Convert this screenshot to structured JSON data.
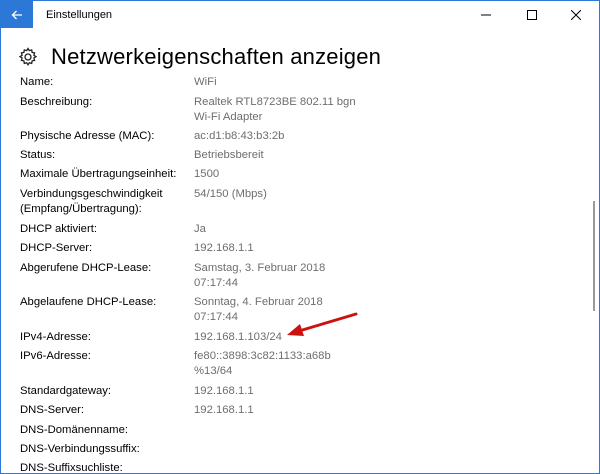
{
  "window": {
    "app_title": "Einstellungen",
    "accent": "#2b78d6"
  },
  "header": {
    "title": "Netzwerkeigenschaften anzeigen",
    "icon": "gear-icon"
  },
  "properties": [
    {
      "label": "Name:",
      "value": "WiFi"
    },
    {
      "label": "Beschreibung:",
      "value": "Realtek RTL8723BE 802.11 bgn\nWi-Fi Adapter"
    },
    {
      "label": "Physische Adresse (MAC):",
      "value": "ac:d1:b8:43:b3:2b"
    },
    {
      "label": "Status:",
      "value": "Betriebsbereit"
    },
    {
      "label": "Maximale Übertragungseinheit:",
      "value": "1500"
    },
    {
      "label": "Verbindungsgeschwindigkeit\n(Empfang/Übertragung):",
      "value": "54/150 (Mbps)"
    },
    {
      "label": "DHCP aktiviert:",
      "value": "Ja"
    },
    {
      "label": "DHCP-Server:",
      "value": "192.168.1.1"
    },
    {
      "label": "Abgerufene DHCP-Lease:",
      "value": "Samstag, 3. Februar 2018\n07:17:44"
    },
    {
      "label": "Abgelaufene DHCP-Lease:",
      "value": "Sonntag, 4. Februar 2018\n07:17:44"
    },
    {
      "label": "IPv4-Adresse:",
      "value": "192.168.1.103/24"
    },
    {
      "label": "IPv6-Adresse:",
      "value": "fe80::3898:3c82:1133:a68b\n%13/64"
    },
    {
      "label": "Standardgateway:",
      "value": "192.168.1.1"
    },
    {
      "label": "DNS-Server:",
      "value": "192.168.1.1"
    },
    {
      "label": "DNS-Domänenname:",
      "value": ""
    },
    {
      "label": "DNS-Verbindungssuffix:",
      "value": ""
    },
    {
      "label": "DNS-Suffixsuchliste:",
      "value": ""
    }
  ],
  "annotation": {
    "arrow_color": "#cc1111"
  }
}
